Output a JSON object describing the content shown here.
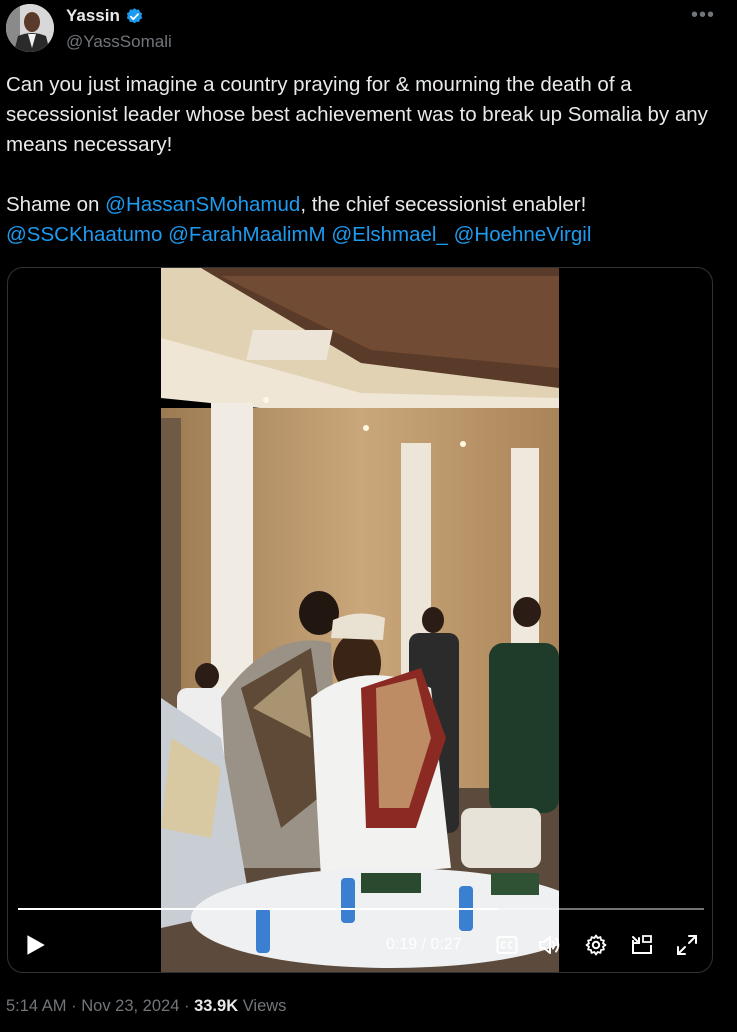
{
  "author": {
    "display_name": "Yassin",
    "handle": "@YassSomali",
    "verified_color": "#1d9bf0"
  },
  "more_icon": "•••",
  "tweet": {
    "line1": "Can you just imagine a country praying for & mourning the death of a secessionist leader whose best achievement was to break up Somalia by any means necessary!",
    "line2_prefix": "Shame on ",
    "line2_mention": "@HassanSMohamud",
    "line2_suffix": ", the chief secessionist enabler!",
    "mentions": [
      "@SSCKhaatumo",
      "@FarahMaalimM",
      "@Elshmael_",
      "@HoehneVirgil"
    ]
  },
  "video": {
    "current_time": "0:19",
    "separator": "/",
    "duration": "0:27",
    "progress_fraction": 0.7,
    "controls": {
      "play": "play-icon",
      "cc": "closed-captions-icon",
      "volume": "volume-icon",
      "settings": "gear-icon",
      "pip": "picture-in-picture-icon",
      "fullscreen": "fullscreen-icon"
    }
  },
  "meta": {
    "time": "5:14 AM",
    "dot1": "·",
    "date": "Nov 23, 2024",
    "dot2": "·",
    "views_count": "33.9K",
    "views_label": "Views"
  },
  "colors": {
    "background": "#000000",
    "text": "#e7e9ea",
    "secondary": "#71767b",
    "link": "#1d9bf0"
  }
}
